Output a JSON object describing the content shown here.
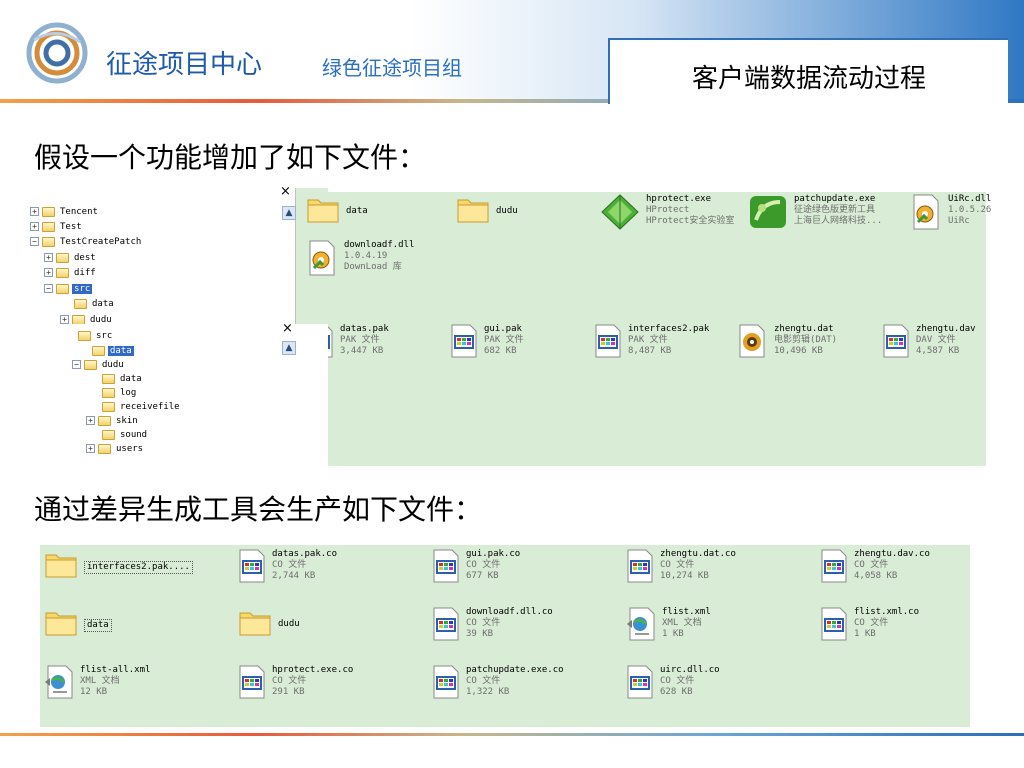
{
  "header": {
    "brand": "征途项目中心",
    "brand_sub": "绿色征途项目组",
    "slide_title": "客户端数据流动过程"
  },
  "section1": {
    "heading": "假设一个功能增加了如下文件："
  },
  "section2": {
    "heading": "通过差异生成工具会生产如下文件："
  },
  "tree1": {
    "close": "×",
    "items": [
      {
        "label": "Tencent",
        "expander": "+"
      },
      {
        "label": "Test",
        "expander": "+"
      },
      {
        "label": "TestCreatePatch",
        "expander": "−"
      },
      {
        "label": "dest",
        "expander": "+"
      },
      {
        "label": "diff",
        "expander": "+"
      },
      {
        "label": "src",
        "expander": "−"
      },
      {
        "label": "data",
        "expander": ""
      },
      {
        "label": "dudu",
        "expander": "+"
      }
    ]
  },
  "tree2": {
    "close": "×",
    "items": [
      {
        "label": "src",
        "expander": ""
      },
      {
        "label": "data",
        "expander": ""
      },
      {
        "label": "dudu",
        "expander": "−"
      },
      {
        "label": "data",
        "expander": ""
      },
      {
        "label": "log",
        "expander": ""
      },
      {
        "label": "receivefile",
        "expander": ""
      },
      {
        "label": "skin",
        "expander": "+"
      },
      {
        "label": "sound",
        "expander": ""
      },
      {
        "label": "users",
        "expander": "+"
      }
    ]
  },
  "pane1_top": [
    {
      "name": "data",
      "l2": "",
      "l3": "",
      "icon": "folder-icon"
    },
    {
      "name": "dudu",
      "l2": "",
      "l3": "",
      "icon": "folder-icon"
    },
    {
      "name": "hprotect.exe",
      "l2": "HProtect",
      "l3": "HProtect安全实验室",
      "icon": "green-diamond-icon"
    },
    {
      "name": "patchupdate.exe",
      "l2": "征途绿色版更新工具",
      "l3": "上海巨人网络科技...",
      "icon": "green-app-icon"
    },
    {
      "name": "UiRc.dll",
      "l2": "1.0.5.26",
      "l3": "UiRc",
      "icon": "dll-icon"
    },
    {
      "name": "downloadf.dll",
      "l2": "1.0.4.19",
      "l3": "DownLoad 库",
      "icon": "dll-icon"
    }
  ],
  "pane1_bottom": [
    {
      "name": "datas.pak",
      "l2": "PAK 文件",
      "l3": "3,447 KB",
      "icon": "generic-file-icon"
    },
    {
      "name": "gui.pak",
      "l2": "PAK 文件",
      "l3": "682 KB",
      "icon": "generic-file-icon"
    },
    {
      "name": "interfaces2.pak",
      "l2": "PAK 文件",
      "l3": "8,487 KB",
      "icon": "generic-file-icon"
    },
    {
      "name": "zhengtu.dat",
      "l2": "电影剪辑(DAT)",
      "l3": "10,496 KB",
      "icon": "media-file-icon"
    },
    {
      "name": "zhengtu.dav",
      "l2": "DAV 文件",
      "l3": "4,587 KB",
      "icon": "generic-file-icon"
    }
  ],
  "pane2": [
    {
      "name": "interfaces2.pak....",
      "l2": "",
      "l3": "",
      "icon": "folder-icon",
      "framed": true
    },
    {
      "name": "datas.pak.co",
      "l2": "CO 文件",
      "l3": "2,744 KB",
      "icon": "generic-file-icon"
    },
    {
      "name": "gui.pak.co",
      "l2": "CO 文件",
      "l3": "677 KB",
      "icon": "generic-file-icon"
    },
    {
      "name": "zhengtu.dat.co",
      "l2": "CO 文件",
      "l3": "10,274 KB",
      "icon": "generic-file-icon"
    },
    {
      "name": "zhengtu.dav.co",
      "l2": "CO 文件",
      "l3": "4,058 KB",
      "icon": "generic-file-icon"
    },
    {
      "name": "data",
      "l2": "",
      "l3": "",
      "icon": "folder-icon",
      "framed": true
    },
    {
      "name": "dudu",
      "l2": "",
      "l3": "",
      "icon": "folder-icon"
    },
    {
      "name": "downloadf.dll.co",
      "l2": "CO 文件",
      "l3": "39 KB",
      "icon": "generic-file-icon"
    },
    {
      "name": "flist.xml",
      "l2": "XML 文档",
      "l3": "1 KB",
      "icon": "xml-file-icon"
    },
    {
      "name": "flist.xml.co",
      "l2": "CO 文件",
      "l3": "1 KB",
      "icon": "generic-file-icon"
    },
    {
      "name": "flist-all.xml",
      "l2": "XML 文档",
      "l3": "12 KB",
      "icon": "xml-file-icon"
    },
    {
      "name": "hprotect.exe.co",
      "l2": "CO 文件",
      "l3": "291 KB",
      "icon": "generic-file-icon"
    },
    {
      "name": "patchupdate.exe.co",
      "l2": "CO 文件",
      "l3": "1,322 KB",
      "icon": "generic-file-icon"
    },
    {
      "name": "uirc.dll.co",
      "l2": "CO 文件",
      "l3": "628 KB",
      "icon": "generic-file-icon"
    }
  ],
  "colors": {
    "pane_bg": "#d9ecd6",
    "brand_blue": "#1e5aa8",
    "selection": "#316ac5"
  }
}
